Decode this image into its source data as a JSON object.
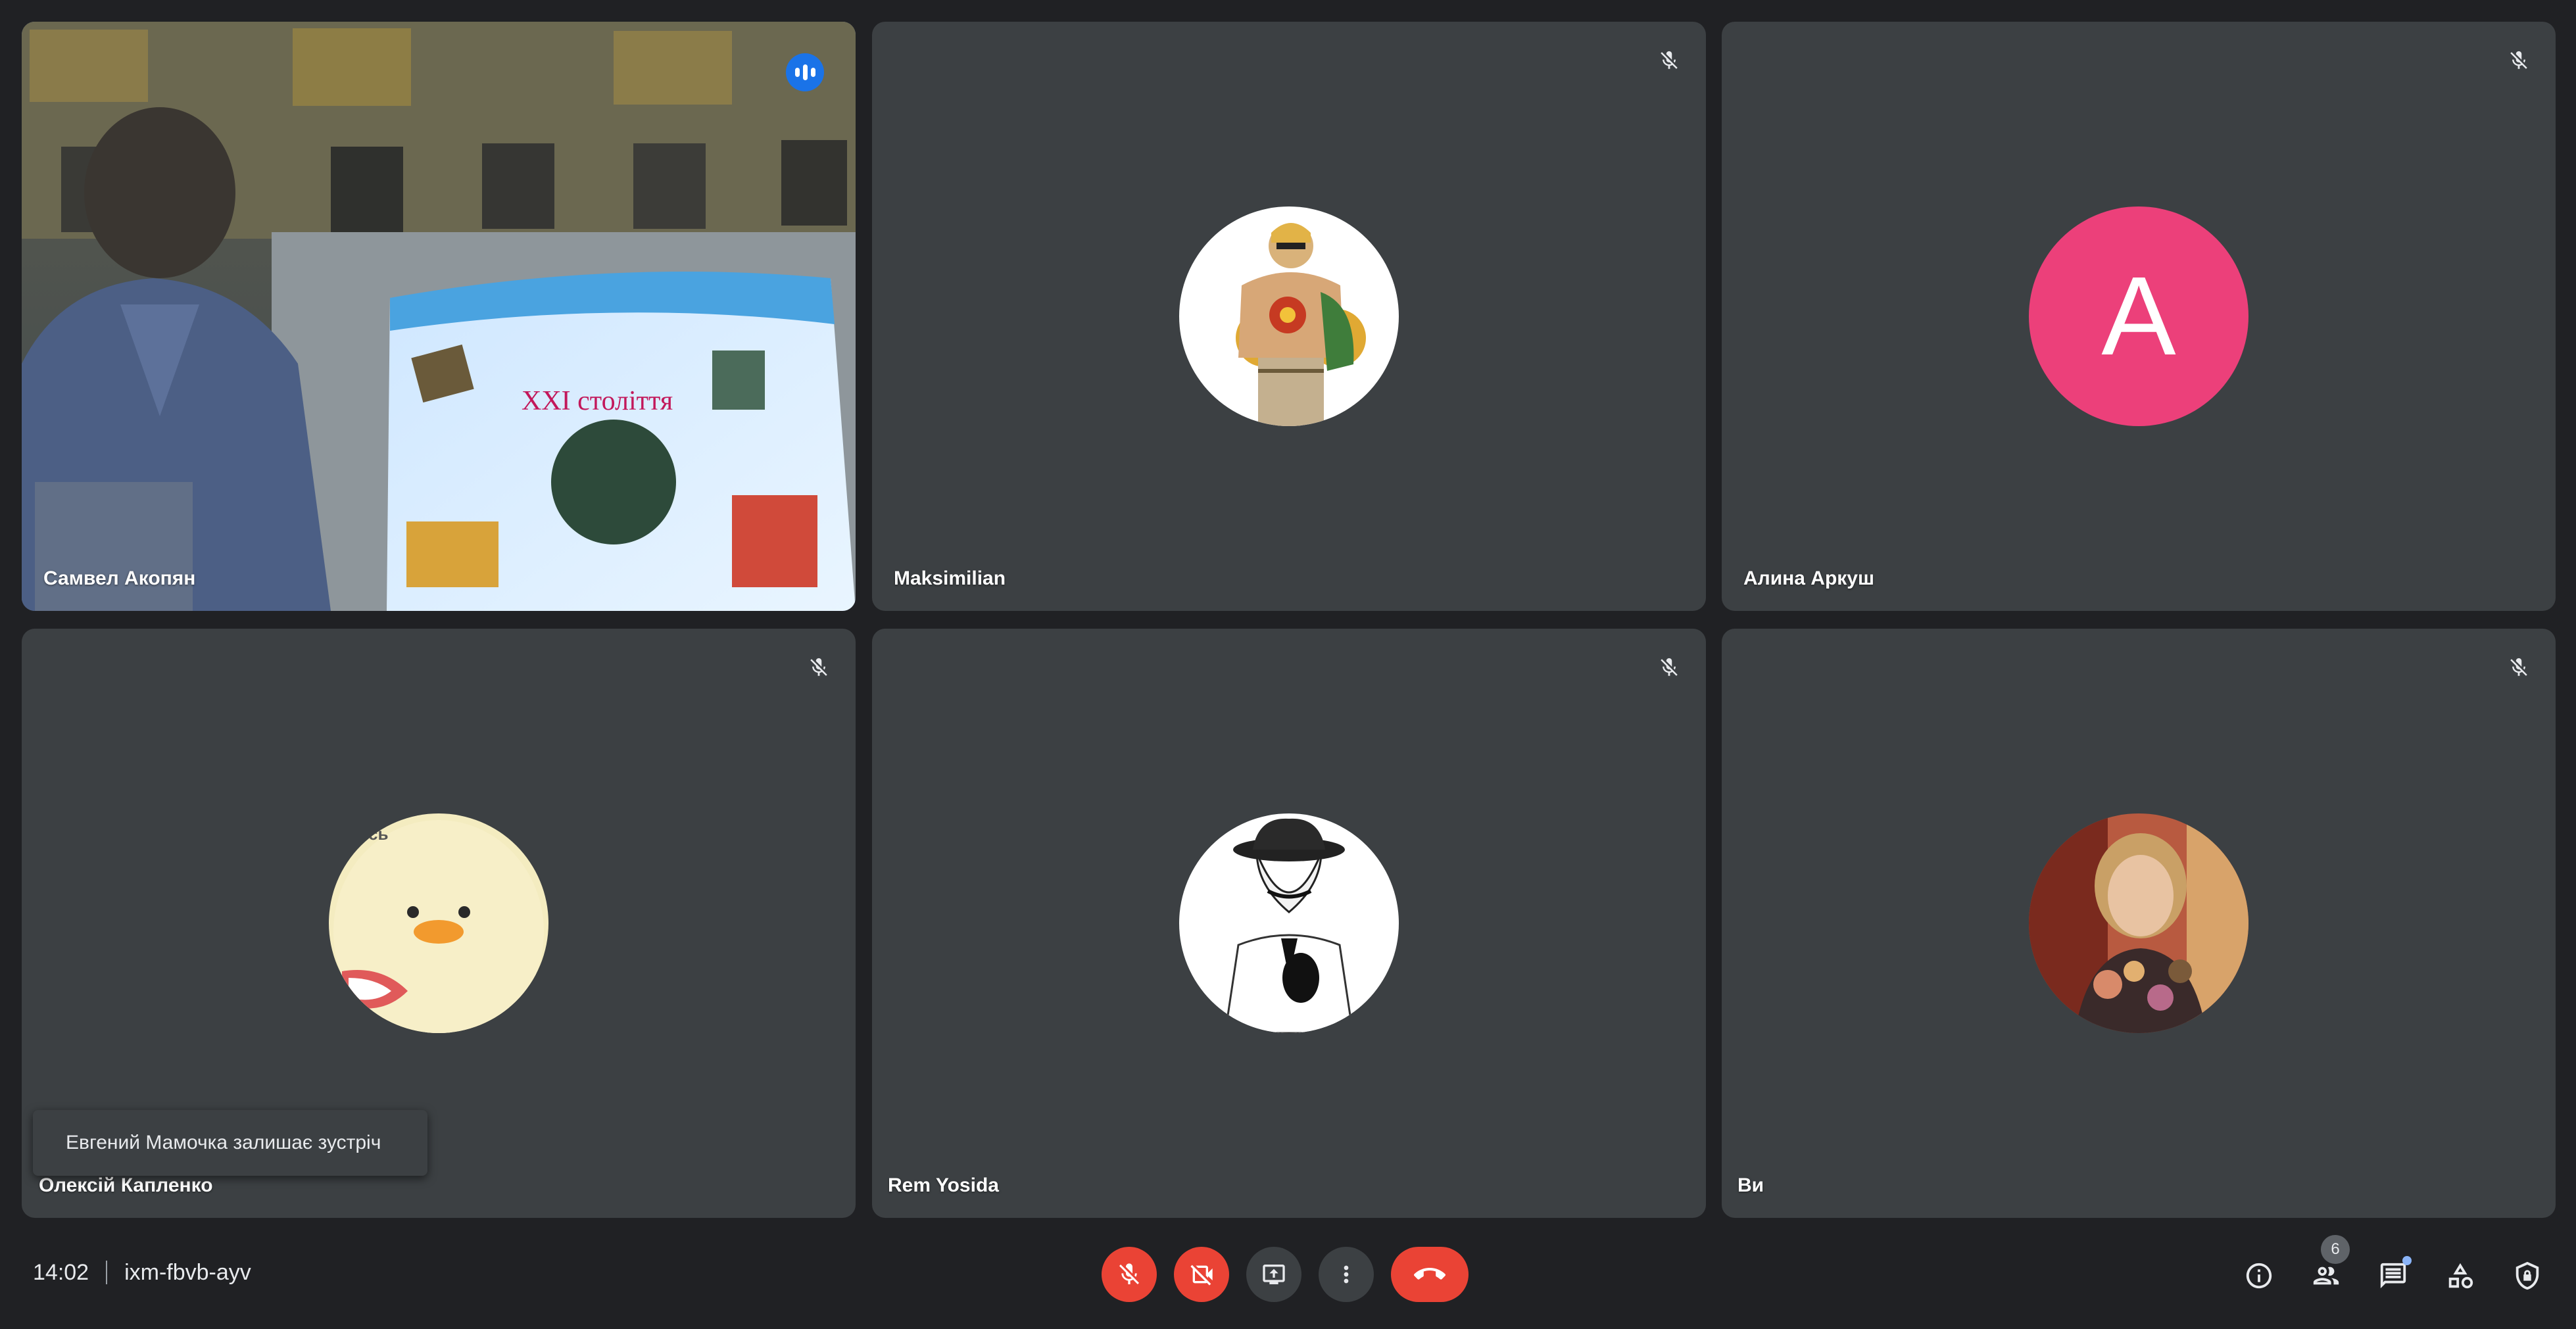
{
  "participants": [
    {
      "name": "Самвел Акопян",
      "speaking": true
    },
    {
      "name": "Maksimilian",
      "muted": true
    },
    {
      "name": "Алина Аркуш",
      "muted": true,
      "avatar_letter": "A",
      "avatar_color": "#ec407a"
    },
    {
      "name": "Олексій Капленко",
      "muted": true
    },
    {
      "name": "Rem Yosida",
      "muted": true
    },
    {
      "name": "Ви",
      "muted": true
    }
  ],
  "video_slide_text": "XXI століття",
  "avatar_partial_text": "сь",
  "toast": {
    "text": "Евгений Мамочка залишає зустріч"
  },
  "meeting": {
    "time": "14:02",
    "code": "ixm-fbvb-ayv"
  },
  "controls": {
    "mic": "mic-off-icon",
    "camera": "camera-off-icon",
    "present": "present-screen-icon",
    "more": "more-vertical-icon",
    "leave": "hang-up-icon"
  },
  "tools": {
    "participants_count": "6"
  },
  "colors": {
    "background": "#202124",
    "tile": "#3c4043",
    "speaking_border": "#8ab4f8",
    "danger": "#ea4335",
    "accent": "#1a73e8"
  }
}
